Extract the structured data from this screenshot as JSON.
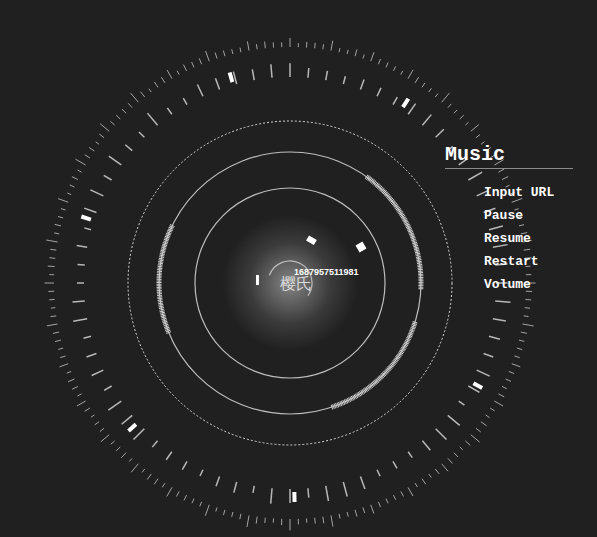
{
  "menu": {
    "title": "Music",
    "items": [
      {
        "label": "Input URL"
      },
      {
        "label": "Pause"
      },
      {
        "label": "Resume"
      },
      {
        "label": "Restart"
      },
      {
        "label": "Volume"
      }
    ]
  },
  "visualizer": {
    "center_label": "樱氏",
    "timestamp": "1687957511981"
  }
}
